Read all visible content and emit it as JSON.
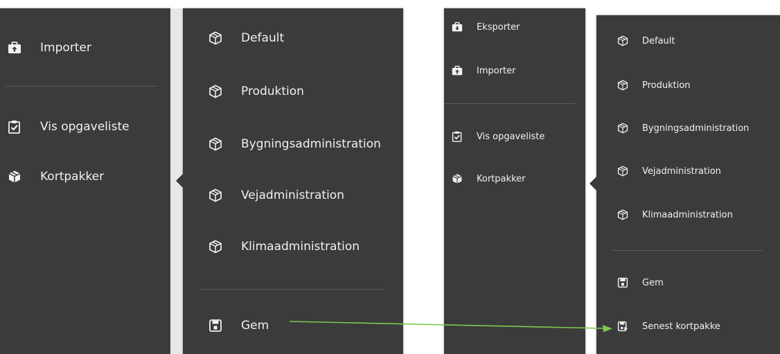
{
  "left": {
    "menu": [
      {
        "label": "Importer",
        "icon": "briefcase-upload-icon"
      },
      {
        "label": "Vis opgaveliste",
        "icon": "clipboard-check-icon"
      },
      {
        "label": "Kortpakker",
        "icon": "package-icon"
      }
    ],
    "submenu": [
      {
        "label": "Default",
        "icon": "package-outline-icon"
      },
      {
        "label": "Produktion",
        "icon": "package-outline-icon"
      },
      {
        "label": "Bygningsadministration",
        "icon": "package-outline-icon"
      },
      {
        "label": "Vejadministration",
        "icon": "package-outline-icon"
      },
      {
        "label": "Klimaadministration",
        "icon": "package-outline-icon"
      }
    ],
    "save": {
      "label": "Gem",
      "icon": "save-icon"
    }
  },
  "right": {
    "menu": [
      {
        "label": "Eksporter",
        "icon": "briefcase-download-icon"
      },
      {
        "label": "Importer",
        "icon": "briefcase-upload-icon"
      },
      {
        "label": "Vis opgaveliste",
        "icon": "clipboard-check-icon"
      },
      {
        "label": "Kortpakker",
        "icon": "package-icon"
      }
    ],
    "submenu": [
      {
        "label": "Default",
        "icon": "package-outline-icon"
      },
      {
        "label": "Produktion",
        "icon": "package-outline-icon"
      },
      {
        "label": "Bygningsadministration",
        "icon": "package-outline-icon"
      },
      {
        "label": "Vejadministration",
        "icon": "package-outline-icon"
      },
      {
        "label": "Klimaadministration",
        "icon": "package-outline-icon"
      }
    ],
    "save": {
      "label": "Gem",
      "icon": "save-icon"
    },
    "latest": {
      "label": "Senest kortpakke",
      "icon": "save-restore-icon"
    }
  },
  "colors": {
    "panel": "#3b3b3b",
    "text": "#f1f1f1",
    "divider": "#5a5a5a",
    "arrow": "#7ec850"
  }
}
